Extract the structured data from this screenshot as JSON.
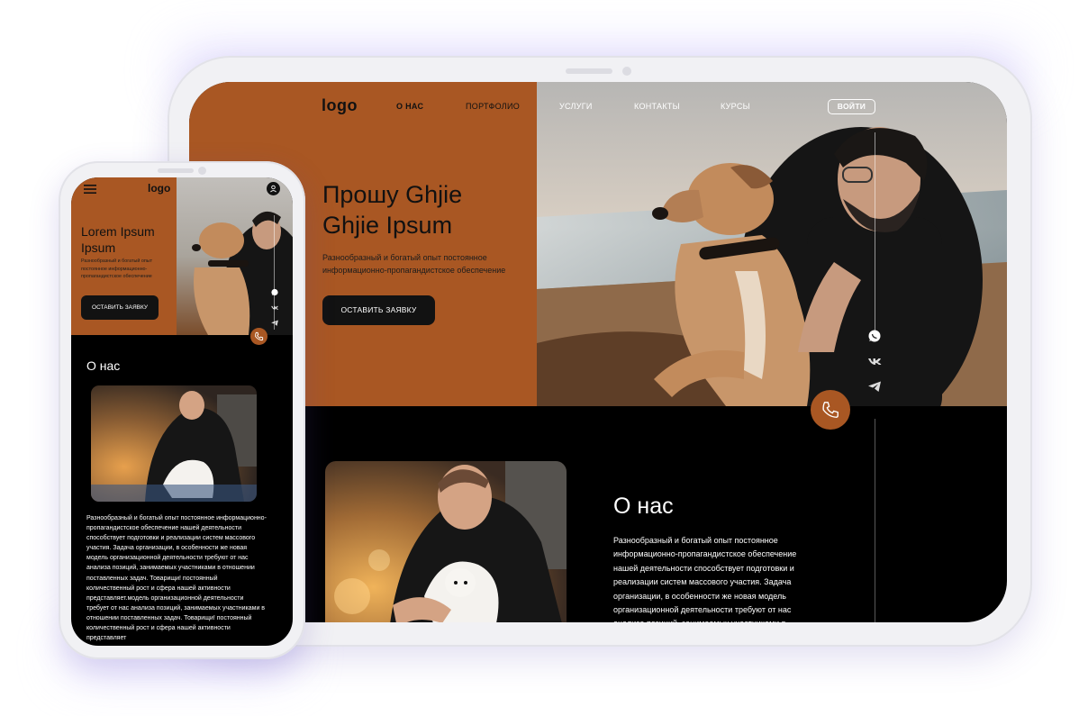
{
  "tablet": {
    "nav": {
      "logo": "logo",
      "items": [
        "О НАС",
        "ПОРТФОЛИО",
        "УСЛУГИ",
        "КОНТАКТЫ",
        "КУРСЫ"
      ],
      "login": "ВОЙТИ"
    },
    "hero": {
      "title_line1": "Прошу Ghjie",
      "title_line2": "Ghjie Ipsum",
      "subtitle": "Разнообразный и богатый опыт постоянное информационно-пропагандистское обеспечение",
      "cta": "ОСТАВИТЬ ЗАЯВКУ"
    },
    "social": [
      "whatsapp-icon",
      "vk-icon",
      "telegram-icon"
    ],
    "about": {
      "title": "О нас",
      "text": "Разнообразный и богатый опыт постоянное информационно-пропагандистское обеспечение нашей деятельности способствует подготовки и реализации систем массового участия. Задача организации, в особенности же новая модель организационной деятельности требуют от нас анализа позиций, занимаемых участниками в"
    }
  },
  "phone": {
    "nav": {
      "logo": "logo"
    },
    "hero": {
      "title": "Lorem Ipsum Ipsum",
      "subtitle": "Разнообразный и богатый опыт постоянное информационно-пропагандистское обеспечение",
      "cta": "ОСТАВИТЬ ЗАЯВКУ"
    },
    "about": {
      "title": "О нас",
      "text": "Разнообразный и богатый опыт постоянное информационно-пропагандистское обеспечение нашей деятельности способствует подготовки и реализации систем массового участия. Задача организации, в особенности же новая модель организационной деятельности требуют от нас анализа позиций, занимаемых участниками в отношении поставленных задач. Товарищи! постоянный количественный рост и сфера нашей активности представляет.модель организационной деятельности требует от нас анализа позиций, занимаемых участниками в отношении поставленных задач. Товарищи! постоянный количественный рост и сфера нашей активности представляет"
    }
  },
  "colors": {
    "accent": "#a95723",
    "dark": "#000000",
    "button": "#121212"
  }
}
